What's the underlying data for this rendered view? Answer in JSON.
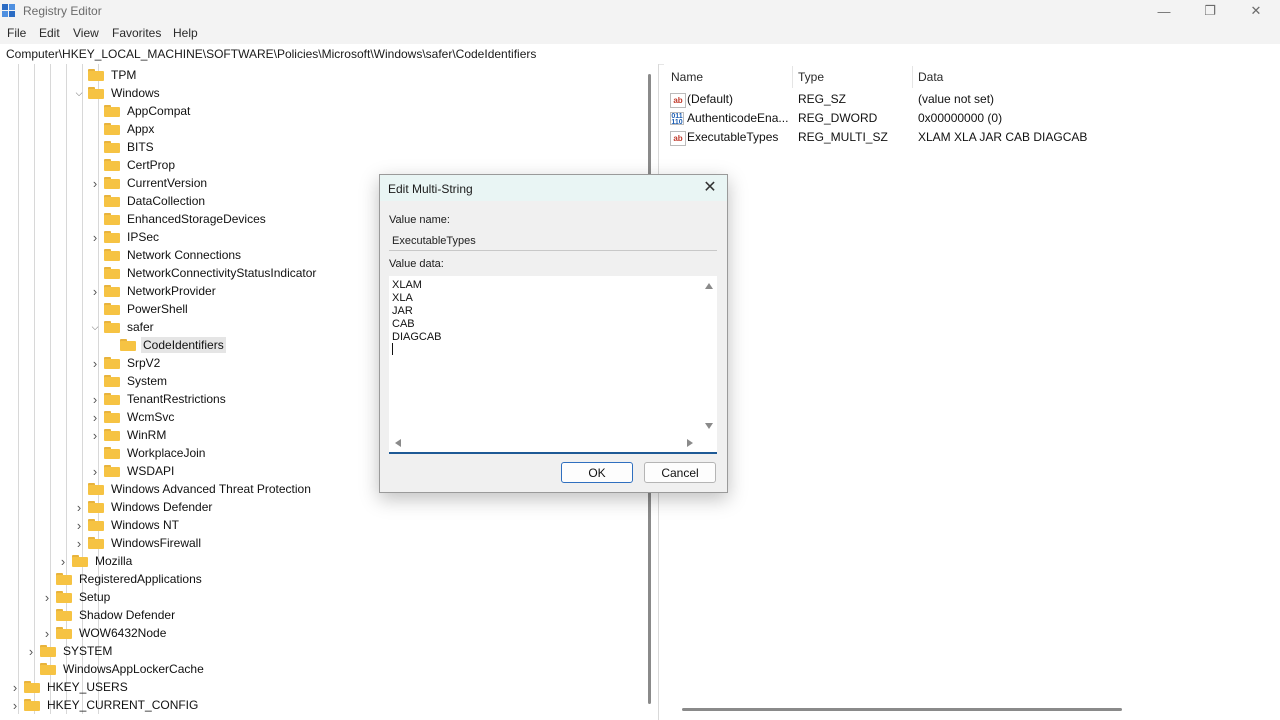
{
  "window": {
    "title": "Registry Editor",
    "minimize_glyph": "—",
    "restore_glyph": "❐",
    "close_glyph": "✕"
  },
  "menu": [
    "File",
    "Edit",
    "View",
    "Favorites",
    "Help"
  ],
  "address": "Computer\\HKEY_LOCAL_MACHINE\\SOFTWARE\\Policies\\Microsoft\\Windows\\safer\\CodeIdentifiers",
  "tree": [
    {
      "label": "TPM",
      "depth": 5,
      "expander": "none"
    },
    {
      "label": "Windows",
      "depth": 5,
      "expander": "expanded"
    },
    {
      "label": "AppCompat",
      "depth": 6,
      "expander": "none"
    },
    {
      "label": "Appx",
      "depth": 6,
      "expander": "none"
    },
    {
      "label": "BITS",
      "depth": 6,
      "expander": "none"
    },
    {
      "label": "CertProp",
      "depth": 6,
      "expander": "none"
    },
    {
      "label": "CurrentVersion",
      "depth": 6,
      "expander": "collapsed"
    },
    {
      "label": "DataCollection",
      "depth": 6,
      "expander": "none"
    },
    {
      "label": "EnhancedStorageDevices",
      "depth": 6,
      "expander": "none"
    },
    {
      "label": "IPSec",
      "depth": 6,
      "expander": "collapsed"
    },
    {
      "label": "Network Connections",
      "depth": 6,
      "expander": "none"
    },
    {
      "label": "NetworkConnectivityStatusIndicator",
      "depth": 6,
      "expander": "none"
    },
    {
      "label": "NetworkProvider",
      "depth": 6,
      "expander": "collapsed"
    },
    {
      "label": "PowerShell",
      "depth": 6,
      "expander": "none"
    },
    {
      "label": "safer",
      "depth": 6,
      "expander": "expanded"
    },
    {
      "label": "CodeIdentifiers",
      "depth": 7,
      "expander": "none",
      "selected": true
    },
    {
      "label": "SrpV2",
      "depth": 6,
      "expander": "collapsed"
    },
    {
      "label": "System",
      "depth": 6,
      "expander": "none"
    },
    {
      "label": "TenantRestrictions",
      "depth": 6,
      "expander": "collapsed"
    },
    {
      "label": "WcmSvc",
      "depth": 6,
      "expander": "collapsed"
    },
    {
      "label": "WinRM",
      "depth": 6,
      "expander": "collapsed"
    },
    {
      "label": "WorkplaceJoin",
      "depth": 6,
      "expander": "none"
    },
    {
      "label": "WSDAPI",
      "depth": 6,
      "expander": "collapsed"
    },
    {
      "label": "Windows Advanced Threat Protection",
      "depth": 5,
      "expander": "none"
    },
    {
      "label": "Windows Defender",
      "depth": 5,
      "expander": "collapsed"
    },
    {
      "label": "Windows NT",
      "depth": 5,
      "expander": "collapsed"
    },
    {
      "label": "WindowsFirewall",
      "depth": 5,
      "expander": "collapsed"
    },
    {
      "label": "Mozilla",
      "depth": 4,
      "expander": "collapsed"
    },
    {
      "label": "RegisteredApplications",
      "depth": 3,
      "expander": "none"
    },
    {
      "label": "Setup",
      "depth": 3,
      "expander": "collapsed"
    },
    {
      "label": "Shadow Defender",
      "depth": 3,
      "expander": "none"
    },
    {
      "label": "WOW6432Node",
      "depth": 3,
      "expander": "collapsed"
    },
    {
      "label": "SYSTEM",
      "depth": 2,
      "expander": "collapsed"
    },
    {
      "label": "WindowsAppLockerCache",
      "depth": 2,
      "expander": "none"
    },
    {
      "label": "HKEY_USERS",
      "depth": 1,
      "expander": "collapsed"
    },
    {
      "label": "HKEY_CURRENT_CONFIG",
      "depth": 1,
      "expander": "collapsed"
    }
  ],
  "list": {
    "columns": [
      "Name",
      "Type",
      "Data"
    ],
    "rows": [
      {
        "icon": "string-value-icon",
        "icon_text": "ab",
        "name": "(Default)",
        "type": "REG_SZ",
        "data": "(value not set)"
      },
      {
        "icon": "dword-value-icon",
        "icon_text": "011\n110",
        "name": "AuthenticodeEna...",
        "type": "REG_DWORD",
        "data": "0x00000000 (0)"
      },
      {
        "icon": "string-value-icon",
        "icon_text": "ab",
        "name": "ExecutableTypes",
        "type": "REG_MULTI_SZ",
        "data": "XLAM XLA JAR CAB DIAGCAB"
      }
    ]
  },
  "dialog": {
    "title": "Edit Multi-String",
    "close_glyph": "✕",
    "value_name_label": "Value name:",
    "value_name": "ExecutableTypes",
    "value_data_label": "Value data:",
    "value_data_lines": [
      "XLAM",
      "XLA",
      "JAR",
      "CAB",
      "DIAGCAB"
    ],
    "ok_label": "OK",
    "cancel_label": "Cancel"
  },
  "colors": {
    "folder": "#f6c343",
    "dialog_title_bg": "#e9f5f4",
    "accent": "#1e5a96"
  }
}
